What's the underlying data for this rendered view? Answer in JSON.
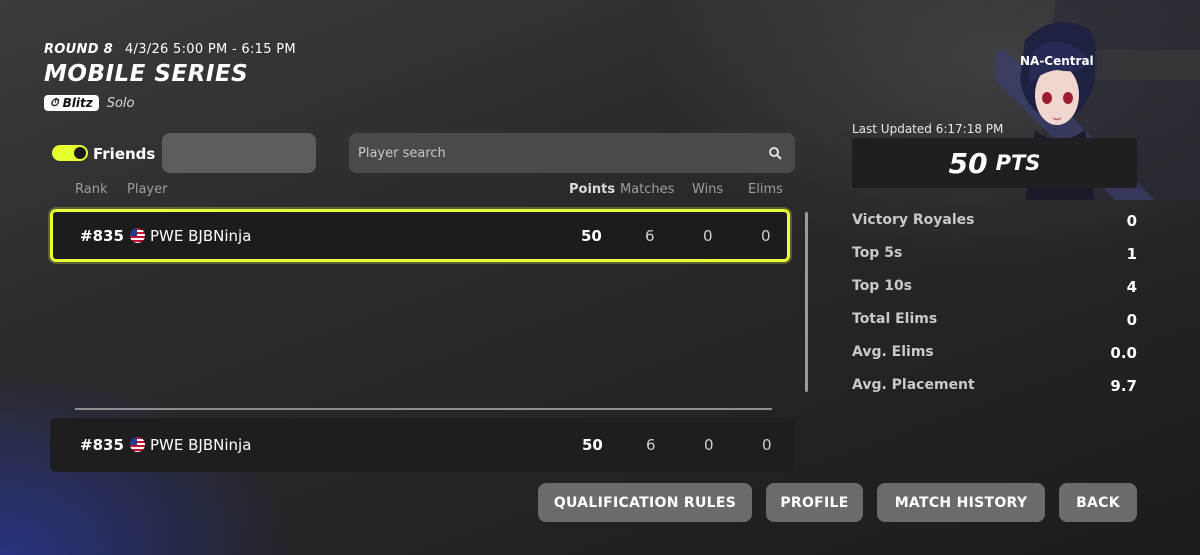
{
  "header": {
    "round": "ROUND 8",
    "time": "4/3/26 5:00 PM - 6:15 PM",
    "title": "MOBILE SERIES",
    "mode_badge": "Blitz",
    "mode_type": "Solo"
  },
  "controls": {
    "friends_label": "Friends",
    "friends_toggle_on": true,
    "search_placeholder": "Player search"
  },
  "table": {
    "columns": [
      "Rank",
      "Player",
      "Points",
      "Matches",
      "Wins",
      "Elims"
    ],
    "rows": [
      {
        "rank": "#835",
        "player": "PWE BJBNinja",
        "points": "50",
        "matches": "6",
        "wins": "0",
        "elims": "0"
      }
    ],
    "my_row": {
      "rank": "#835",
      "player": "PWE BJBNinja",
      "points": "50",
      "matches": "6",
      "wins": "0",
      "elims": "0"
    }
  },
  "panel": {
    "region": "NA-Central",
    "last_updated": "Last Updated 6:17:18 PM",
    "points_value": "50",
    "points_unit": "PTS",
    "stats": [
      {
        "label": "Victory Royales",
        "value": "0"
      },
      {
        "label": "Top 5s",
        "value": "1"
      },
      {
        "label": "Top 10s",
        "value": "4"
      },
      {
        "label": "Total Elims",
        "value": "0"
      },
      {
        "label": "Avg. Elims",
        "value": "0.0"
      },
      {
        "label": "Avg. Placement",
        "value": "9.7"
      }
    ]
  },
  "buttons": {
    "qualification": "QUALIFICATION RULES",
    "profile": "PROFILE",
    "match_history": "MATCH HISTORY",
    "back": "BACK"
  },
  "colors": {
    "accent_yellow": "#e8ff38",
    "background": "#2c2c2e",
    "button": "#6b6b6d"
  }
}
